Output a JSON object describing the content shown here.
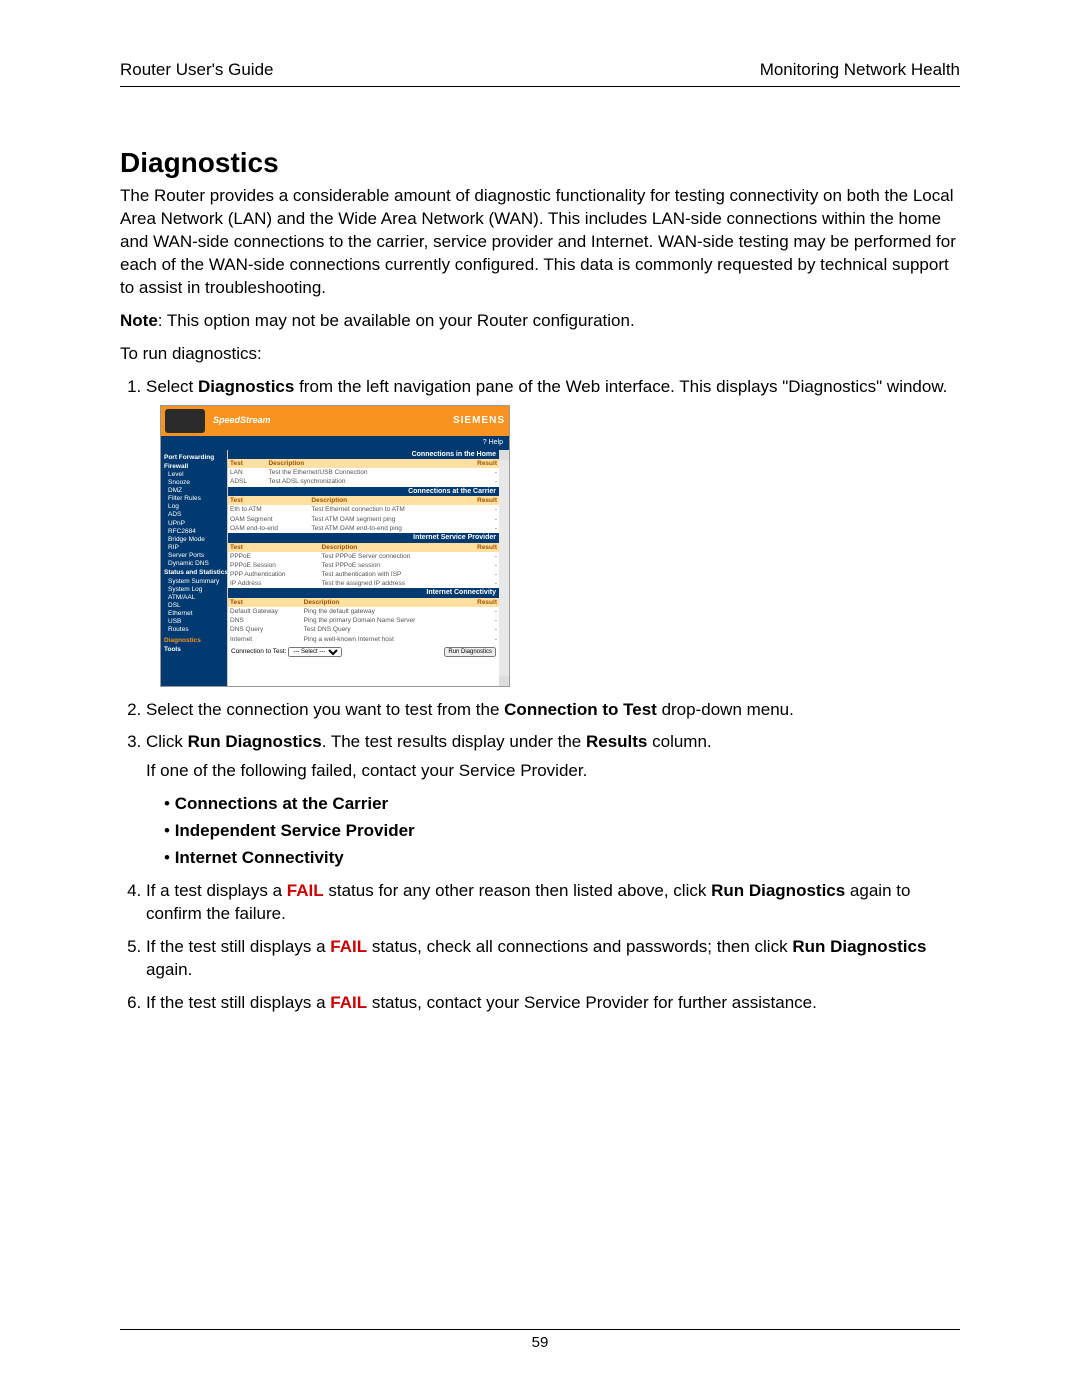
{
  "header": {
    "left": "Router User's Guide",
    "right": "Monitoring Network Health"
  },
  "title": "Diagnostics",
  "intro": "The Router provides a considerable amount of diagnostic functionality for testing connectivity on both the Local Area Network (LAN) and the Wide Area Network (WAN). This includes LAN-side connections within the home and WAN-side connections to the carrier, service provider and Internet. WAN-side testing may be performed for each of the WAN-side connections currently configured. This data is commonly requested by technical support to assist in troubleshooting.",
  "note_label": "Note",
  "note_text": ": This option may not be available on your Router configuration.",
  "torun": "To run diagnostics:",
  "step1_a": "Select ",
  "step1_b": "Diagnostics",
  "step1_c": " from the left navigation pane of the Web interface. This displays \"Diagnostics\" window.",
  "step2_a": "Select the connection you want to test from the ",
  "step2_b": "Connection to Test",
  "step2_c": " drop-down menu.",
  "step3_a": "Click ",
  "step3_b": "Run Diagnostics",
  "step3_c": ". The test results display under the ",
  "step3_d": "Results",
  "step3_e": " column.",
  "step3_sub": "If one of the following failed, contact your Service Provider.",
  "fail_list": [
    "Connections at the Carrier",
    "Independent Service Provider",
    "Internet Connectivity"
  ],
  "step4_a": "If a test displays a ",
  "fail_word": "FAIL",
  "step4_b": " status for any other reason then listed above, click ",
  "step4_c": "Run Diagnostics",
  "step4_d": " again to confirm the failure.",
  "step5_a": "If the test still displays a ",
  "step5_b": " status, check all connections and passwords; then click ",
  "step5_c": "Run Diagnostics",
  "step5_d": " again.",
  "step6_a": "If the test still displays a ",
  "step6_b": " status, contact your Service Provider for further assistance.",
  "page_number": "59",
  "shot": {
    "brand_left": "SpeedStream",
    "brand_right": "SIEMENS",
    "help": "Help",
    "sidebar": {
      "items": [
        "Port Forwarding",
        "Firewall",
        "Level",
        "Snooze",
        "DMZ",
        "Filter Rules",
        "Log",
        "ADS",
        "UPnP",
        "RFC2684",
        "Bridge Mode",
        "RIP",
        "Server Ports",
        "Dynamic DNS"
      ],
      "status_cat": "Status and Statistics",
      "status_items": [
        "System Summary",
        "System Log",
        "ATM/AAL",
        "DSL",
        "Ethernet",
        "USB",
        "Routes"
      ],
      "diag": "Diagnostics",
      "tools": "Tools"
    },
    "cols": {
      "test": "Test",
      "desc": "Description",
      "result": "Result"
    },
    "sections": [
      {
        "title": "Connections in the Home",
        "rows": [
          {
            "t": "LAN",
            "d": "Test the Ethernet/USB Connection",
            "r": "-"
          },
          {
            "t": "ADSL",
            "d": "Test ADSL synchronization",
            "r": "-"
          }
        ]
      },
      {
        "title": "Connections at the Carrier",
        "rows": [
          {
            "t": "Eth to ATM",
            "d": "Test Ethernet connection to ATM",
            "r": "-"
          },
          {
            "t": "OAM Segment",
            "d": "Test ATM OAM segment ping",
            "r": "-"
          },
          {
            "t": "OAM end-to-end",
            "d": "Test ATM OAM end-to-end ping",
            "r": "-"
          }
        ]
      },
      {
        "title": "Internet Service Provider",
        "rows": [
          {
            "t": "PPPoE",
            "d": "Test PPPoE Server connection",
            "r": "-"
          },
          {
            "t": "PPPoE Session",
            "d": "Test PPPoE session",
            "r": "-"
          },
          {
            "t": "PPP Authentication",
            "d": "Test authentication with ISP",
            "r": "-"
          },
          {
            "t": "IP Address",
            "d": "Test the assigned IP address",
            "r": "-"
          }
        ]
      },
      {
        "title": "Internet Connectivity",
        "rows": [
          {
            "t": "Default Gateway",
            "d": "Ping the default gateway",
            "r": "-"
          },
          {
            "t": "DNS",
            "d": "Ping the primary Domain Name Server",
            "r": "-"
          },
          {
            "t": "DNS Query",
            "d": "Test DNS Query",
            "r": "-"
          },
          {
            "t": "Internet",
            "d": "Ping a well-known Internet host",
            "r": "-"
          }
        ]
      }
    ],
    "conn_label": "Connection to Test:",
    "conn_value": "--- Select ---",
    "run_btn": "Run Diagnostics"
  }
}
